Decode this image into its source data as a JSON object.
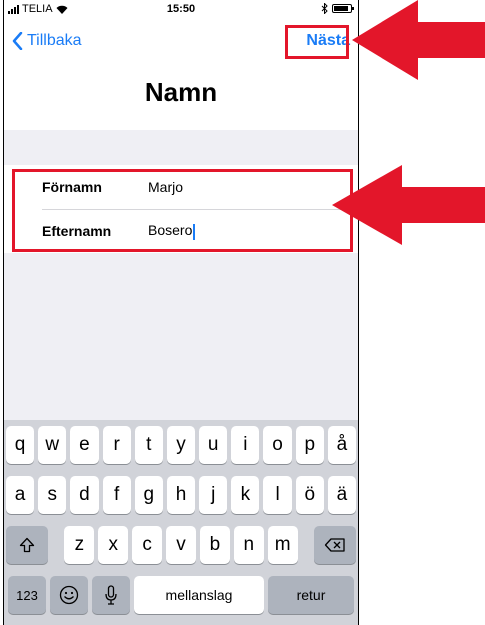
{
  "status_bar": {
    "carrier": "TELIA",
    "time": "15:50"
  },
  "navbar": {
    "back_label": "Tillbaka",
    "next_label": "Nästa"
  },
  "page": {
    "title": "Namn"
  },
  "form": {
    "first_name": {
      "label": "Förnamn",
      "value": "Marjo"
    },
    "last_name": {
      "label": "Efternamn",
      "value": "Bosero"
    }
  },
  "keyboard": {
    "row1": [
      "q",
      "w",
      "e",
      "r",
      "t",
      "y",
      "u",
      "i",
      "o",
      "p",
      "å"
    ],
    "row2": [
      "a",
      "s",
      "d",
      "f",
      "g",
      "h",
      "j",
      "k",
      "l",
      "ö",
      "ä"
    ],
    "row3": [
      "z",
      "x",
      "c",
      "v",
      "b",
      "n",
      "m"
    ],
    "numbers_key": "123",
    "space_key": "mellanslag",
    "return_key": "retur"
  },
  "colors": {
    "accent": "#1a7cf6",
    "annotation": "#e3162a"
  }
}
